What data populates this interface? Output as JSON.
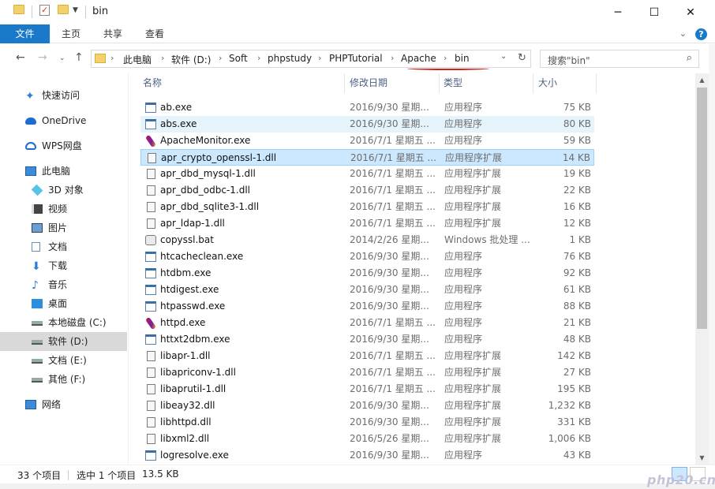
{
  "window": {
    "title": "bin"
  },
  "ribbon": {
    "tabs": [
      "文件",
      "主页",
      "共享",
      "查看"
    ]
  },
  "address": {
    "crumbs": [
      "此电脑",
      "软件 (D:)",
      "Soft",
      "phpstudy",
      "PHPTutorial",
      "Apache",
      "bin"
    ]
  },
  "search": {
    "placeholder": "搜索\"bin\""
  },
  "sidebar": {
    "items": [
      {
        "label": "快速访问",
        "icon": "star-icon"
      },
      {
        "label": "OneDrive",
        "icon": "cloud-icon"
      },
      {
        "label": "WPS网盘",
        "icon": "wps-cloud-icon"
      },
      {
        "label": "此电脑",
        "icon": "computer-icon"
      },
      {
        "label": "3D 对象",
        "icon": "cube-icon"
      },
      {
        "label": "视频",
        "icon": "video-icon"
      },
      {
        "label": "图片",
        "icon": "picture-icon"
      },
      {
        "label": "文档",
        "icon": "document-icon"
      },
      {
        "label": "下载",
        "icon": "download-icon"
      },
      {
        "label": "音乐",
        "icon": "music-icon"
      },
      {
        "label": "桌面",
        "icon": "desktop-icon"
      },
      {
        "label": "本地磁盘 (C:)",
        "icon": "drive-icon"
      },
      {
        "label": "软件 (D:)",
        "icon": "drive-icon"
      },
      {
        "label": "文档 (E:)",
        "icon": "drive-icon"
      },
      {
        "label": "其他 (F:)",
        "icon": "drive-icon"
      },
      {
        "label": "网络",
        "icon": "network-icon"
      }
    ]
  },
  "columns": {
    "name": "名称",
    "date": "修改日期",
    "type": "类型",
    "size": "大小"
  },
  "files": [
    {
      "name": "ab.exe",
      "date": "2016/9/30 星期...",
      "type": "应用程序",
      "size": "75 KB",
      "icon": "exe"
    },
    {
      "name": "abs.exe",
      "date": "2016/9/30 星期...",
      "type": "应用程序",
      "size": "80 KB",
      "icon": "exe"
    },
    {
      "name": "ApacheMonitor.exe",
      "date": "2016/7/1 星期五 ...",
      "type": "应用程序",
      "size": "59 KB",
      "icon": "feather"
    },
    {
      "name": "apr_crypto_openssl-1.dll",
      "date": "2016/7/1 星期五 ...",
      "type": "应用程序扩展",
      "size": "14 KB",
      "icon": "dll"
    },
    {
      "name": "apr_dbd_mysql-1.dll",
      "date": "2016/7/1 星期五 ...",
      "type": "应用程序扩展",
      "size": "19 KB",
      "icon": "dll"
    },
    {
      "name": "apr_dbd_odbc-1.dll",
      "date": "2016/7/1 星期五 ...",
      "type": "应用程序扩展",
      "size": "22 KB",
      "icon": "dll"
    },
    {
      "name": "apr_dbd_sqlite3-1.dll",
      "date": "2016/7/1 星期五 ...",
      "type": "应用程序扩展",
      "size": "16 KB",
      "icon": "dll"
    },
    {
      "name": "apr_ldap-1.dll",
      "date": "2016/7/1 星期五 ...",
      "type": "应用程序扩展",
      "size": "12 KB",
      "icon": "dll"
    },
    {
      "name": "copyssl.bat",
      "date": "2014/2/26 星期...",
      "type": "Windows 批处理 ...",
      "size": "1 KB",
      "icon": "bat"
    },
    {
      "name": "htcacheclean.exe",
      "date": "2016/9/30 星期...",
      "type": "应用程序",
      "size": "76 KB",
      "icon": "exe"
    },
    {
      "name": "htdbm.exe",
      "date": "2016/9/30 星期...",
      "type": "应用程序",
      "size": "92 KB",
      "icon": "exe"
    },
    {
      "name": "htdigest.exe",
      "date": "2016/9/30 星期...",
      "type": "应用程序",
      "size": "61 KB",
      "icon": "exe"
    },
    {
      "name": "htpasswd.exe",
      "date": "2016/9/30 星期...",
      "type": "应用程序",
      "size": "88 KB",
      "icon": "exe"
    },
    {
      "name": "httpd.exe",
      "date": "2016/7/1 星期五 ...",
      "type": "应用程序",
      "size": "21 KB",
      "icon": "feather"
    },
    {
      "name": "httxt2dbm.exe",
      "date": "2016/9/30 星期...",
      "type": "应用程序",
      "size": "48 KB",
      "icon": "exe"
    },
    {
      "name": "libapr-1.dll",
      "date": "2016/7/1 星期五 ...",
      "type": "应用程序扩展",
      "size": "142 KB",
      "icon": "dll"
    },
    {
      "name": "libapriconv-1.dll",
      "date": "2016/7/1 星期五 ...",
      "type": "应用程序扩展",
      "size": "27 KB",
      "icon": "dll"
    },
    {
      "name": "libaprutil-1.dll",
      "date": "2016/7/1 星期五 ...",
      "type": "应用程序扩展",
      "size": "195 KB",
      "icon": "dll"
    },
    {
      "name": "libeay32.dll",
      "date": "2016/9/30 星期...",
      "type": "应用程序扩展",
      "size": "1,232 KB",
      "icon": "dll"
    },
    {
      "name": "libhttpd.dll",
      "date": "2016/9/30 星期...",
      "type": "应用程序扩展",
      "size": "331 KB",
      "icon": "dll"
    },
    {
      "name": "libxml2.dll",
      "date": "2016/5/26 星期...",
      "type": "应用程序扩展",
      "size": "1,006 KB",
      "icon": "dll"
    },
    {
      "name": "logresolve.exe",
      "date": "2016/9/30 星期...",
      "type": "应用程序",
      "size": "43 KB",
      "icon": "exe"
    }
  ],
  "hovered_index": 1,
  "selected_index": 3,
  "status": {
    "count": "33 个项目",
    "selection": "选中 1 个项目",
    "size": "13.5 KB"
  },
  "watermark": "php20.cn",
  "colors": {
    "accent": "#1979ca",
    "selection": "#cce8ff",
    "hover": "#e5f3fb",
    "annotation": "#d9201b"
  }
}
